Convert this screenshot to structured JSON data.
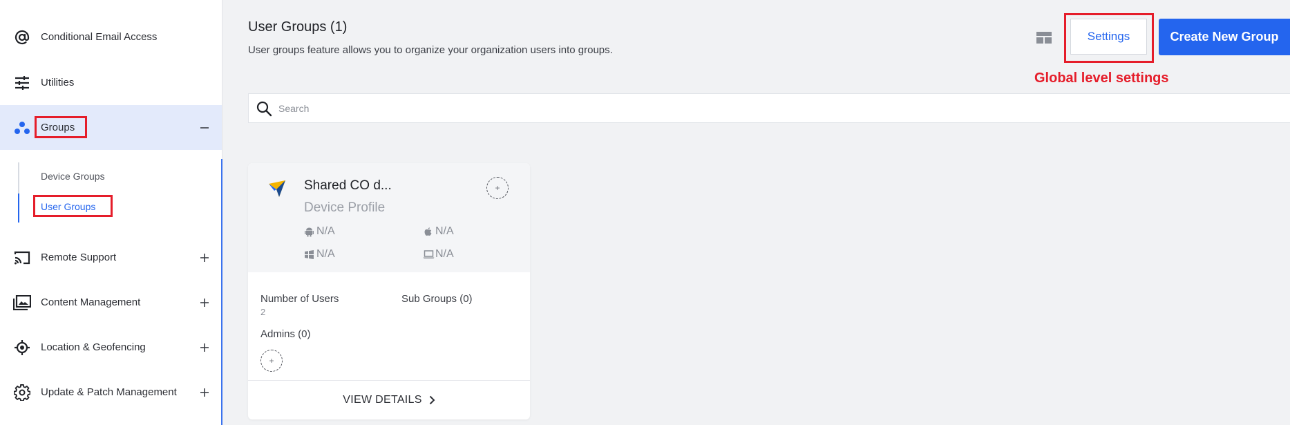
{
  "sidebar": {
    "items": [
      {
        "label": "Conditional Email Access",
        "icon": "at-sign-icon"
      },
      {
        "label": "Utilities",
        "icon": "sliders-icon"
      },
      {
        "label": "Groups",
        "icon": "groups-icon",
        "toggle": "minus"
      },
      {
        "label": "Remote Support",
        "icon": "cast-icon",
        "toggle": "plus"
      },
      {
        "label": "Content Management",
        "icon": "photo-library-icon",
        "toggle": "plus"
      },
      {
        "label": "Location & Geofencing",
        "icon": "location-target-icon",
        "toggle": "plus"
      },
      {
        "label": "Update & Patch Management",
        "icon": "gear-icon",
        "toggle": "plus"
      }
    ],
    "sub_items": [
      {
        "label": "Device Groups"
      },
      {
        "label": "User Groups",
        "active": true
      }
    ]
  },
  "header": {
    "title": "User Groups (1)",
    "description": "User groups feature allows you to organize your organization users into groups.",
    "settings_label": "Settings",
    "create_label": "Create New Group",
    "annotation": "Global level settings"
  },
  "search": {
    "placeholder": "Search"
  },
  "card": {
    "title": "Shared CO d...",
    "subtitle": "Device Profile",
    "platforms": [
      {
        "icon": "android-icon",
        "value": "N/A"
      },
      {
        "icon": "apple-icon",
        "value": "N/A"
      },
      {
        "icon": "windows-icon",
        "value": "N/A"
      },
      {
        "icon": "laptop-icon",
        "value": "N/A"
      }
    ],
    "users_label": "Number of Users",
    "users_value": "2",
    "subgroups_label": "Sub Groups (0)",
    "admins_label": "Admins (0)",
    "add_symbol": "+",
    "view_details": "VIEW DETAILS"
  },
  "colors": {
    "accent": "#2465ee",
    "highlight": "#e51d2a",
    "active_bg": "#e3eafb"
  }
}
